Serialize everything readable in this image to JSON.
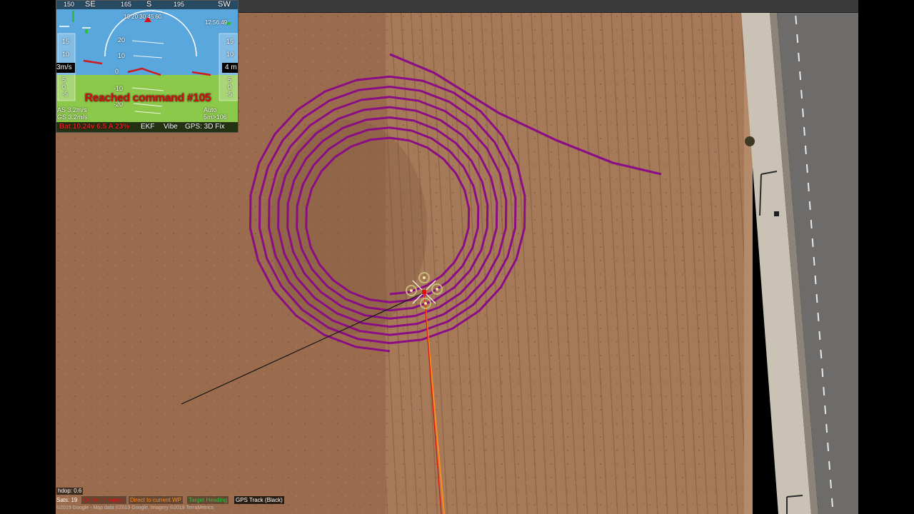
{
  "hud": {
    "compass": [
      "150",
      "SE",
      "165",
      "S",
      "195",
      "SW"
    ],
    "speed_label": "3m/s",
    "alt_label": "4 m",
    "speed_ticks": [
      "15",
      "10",
      "5",
      "0",
      "-5"
    ],
    "alt_ticks": [
      "15",
      "10",
      "5",
      "0",
      "-5"
    ],
    "pitch_labels": [
      "20",
      "10",
      "0",
      "-10",
      "-20"
    ],
    "roll_scale": "10 20 30 45 60",
    "status_top_right": "time",
    "time": "12:56:49",
    "message": "Reached command #105",
    "airspeed": "AS 3.2m/s",
    "groundspeed": "GS 3.2m/s",
    "mode": "Auto",
    "wp_dist": "5m>106",
    "battery": "Bat 10.24v 6.5 A 23%",
    "ekf": "EKF",
    "vibe": "Vibe",
    "gps": "GPS: 3D Fix",
    "colors": {
      "sky": "#5aa7dd",
      "ground": "#8cc84a",
      "message": "#d01010"
    }
  },
  "map": {
    "hdop": "hdop: 0.6",
    "sats": "Sats: 19",
    "legend": [
      {
        "label": "Current Heading",
        "color": "#e01010"
      },
      {
        "label": "Direct to current WP",
        "color": "#ff8c1a"
      },
      {
        "label": "Target Heading",
        "color": "#2fbf3f"
      },
      {
        "label": "GPS Track (Black)",
        "color": "#ffffff"
      }
    ],
    "copyright": "©2019 Google - Map data ©2019 Google, Imagery ©2019 TerraMetrics",
    "track_color": "#8b0d86"
  }
}
